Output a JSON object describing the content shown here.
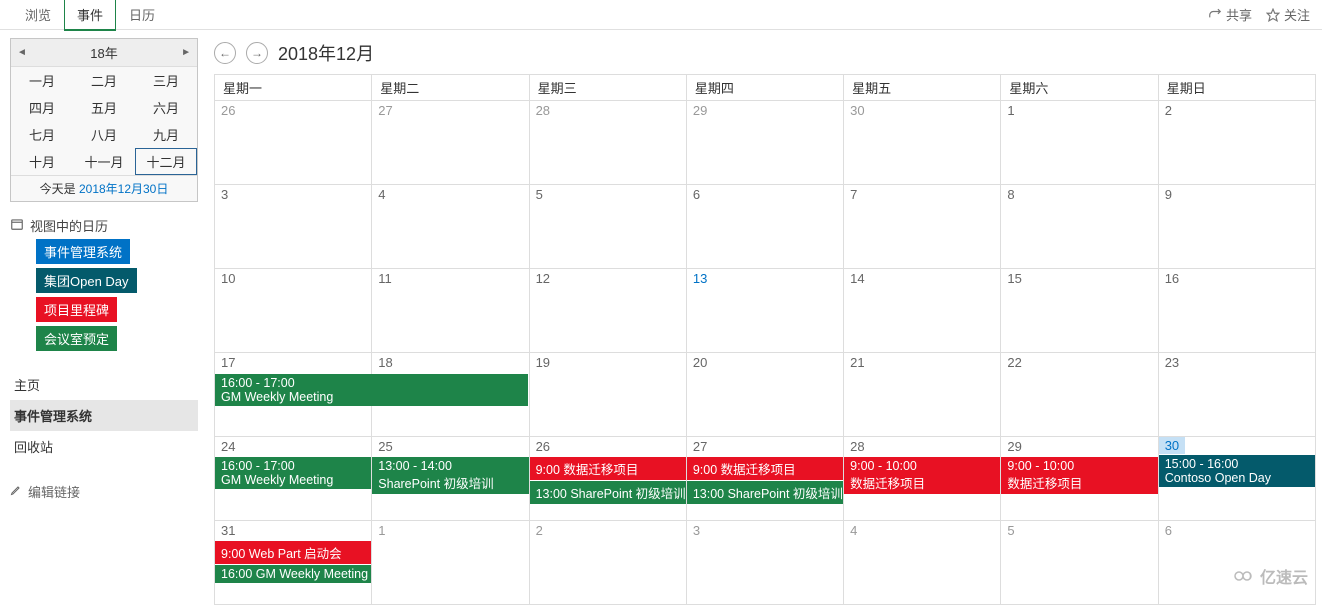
{
  "tabs": {
    "browse": "浏览",
    "events": "事件",
    "calendar": "日历",
    "active": "events"
  },
  "actions": {
    "share": "共享",
    "follow": "关注"
  },
  "datepicker": {
    "year": "18年",
    "months": [
      "一月",
      "二月",
      "三月",
      "四月",
      "五月",
      "六月",
      "七月",
      "八月",
      "九月",
      "十月",
      "十一月",
      "十二月"
    ],
    "selected": 11,
    "today_prefix": "今天是",
    "today_link": "2018年12月30日"
  },
  "sidebar": {
    "calendars_title": "视图中的日历",
    "calendars": [
      {
        "label": "事件管理系统",
        "color": "#0072c6"
      },
      {
        "label": "集团Open Day",
        "color": "#045a6b"
      },
      {
        "label": "项目里程碑",
        "color": "#e81123"
      },
      {
        "label": "会议室预定",
        "color": "#1e8449"
      }
    ],
    "links": [
      {
        "label": "主页",
        "active": false
      },
      {
        "label": "事件管理系统",
        "active": true
      },
      {
        "label": "回收站",
        "active": false
      }
    ],
    "edit_links": "编辑链接"
  },
  "calendar": {
    "title": "2018年12月",
    "dow": [
      "星期一",
      "星期二",
      "星期三",
      "星期四",
      "星期五",
      "星期六",
      "星期日"
    ],
    "weeks": [
      [
        {
          "d": "26",
          "other": true
        },
        {
          "d": "27",
          "other": true
        },
        {
          "d": "28",
          "other": true
        },
        {
          "d": "29",
          "other": true
        },
        {
          "d": "30",
          "other": true
        },
        {
          "d": "1"
        },
        {
          "d": "2"
        }
      ],
      [
        {
          "d": "3"
        },
        {
          "d": "4"
        },
        {
          "d": "5"
        },
        {
          "d": "6"
        },
        {
          "d": "7"
        },
        {
          "d": "8"
        },
        {
          "d": "9"
        }
      ],
      [
        {
          "d": "10"
        },
        {
          "d": "11"
        },
        {
          "d": "12"
        },
        {
          "d": "13",
          "link": true
        },
        {
          "d": "14"
        },
        {
          "d": "15"
        },
        {
          "d": "16"
        }
      ],
      [
        {
          "d": "17",
          "events": [
            {
              "time": "16:00 - 17:00",
              "title": "GM Weekly Meeting",
              "color": "c-green",
              "span": 2
            }
          ]
        },
        {
          "d": "18"
        },
        {
          "d": "19"
        },
        {
          "d": "20"
        },
        {
          "d": "21"
        },
        {
          "d": "22"
        },
        {
          "d": "23"
        }
      ],
      [
        {
          "d": "24",
          "events": [
            {
              "time": "16:00 - 17:00",
              "title": "GM Weekly Meeting",
              "color": "c-green"
            }
          ]
        },
        {
          "d": "25",
          "events": [
            {
              "time": "13:00 - 14:00",
              "title": "SharePoint 初级培训",
              "color": "c-green"
            }
          ]
        },
        {
          "d": "26",
          "events": [
            {
              "single": "9:00 数据迁移项目",
              "color": "c-red"
            },
            {
              "single": "13:00 SharePoint 初级培训",
              "color": "c-green"
            }
          ]
        },
        {
          "d": "27",
          "events": [
            {
              "single": "9:00 数据迁移项目",
              "color": "c-red"
            },
            {
              "single": "13:00 SharePoint 初级培训",
              "color": "c-green"
            }
          ]
        },
        {
          "d": "28",
          "events": [
            {
              "time": "9:00 - 10:00",
              "title": "数据迁移项目",
              "color": "c-red"
            }
          ]
        },
        {
          "d": "29",
          "events": [
            {
              "time": "9:00 - 10:00",
              "title": "数据迁移项目",
              "color": "c-red"
            }
          ]
        },
        {
          "d": "30",
          "today": true,
          "events": [
            {
              "time": "15:00 - 16:00",
              "title": "Contoso Open Day",
              "color": "c-dark"
            }
          ]
        }
      ],
      [
        {
          "d": "31",
          "events": [
            {
              "single": "9:00 Web Part 启动会",
              "color": "c-red"
            },
            {
              "single": "16:00 GM Weekly Meeting",
              "color": "c-green"
            }
          ]
        },
        {
          "d": "1",
          "other": true
        },
        {
          "d": "2",
          "other": true
        },
        {
          "d": "3",
          "other": true
        },
        {
          "d": "4",
          "other": true
        },
        {
          "d": "5",
          "other": true
        },
        {
          "d": "6",
          "other": true
        }
      ]
    ]
  },
  "watermark": "亿速云"
}
